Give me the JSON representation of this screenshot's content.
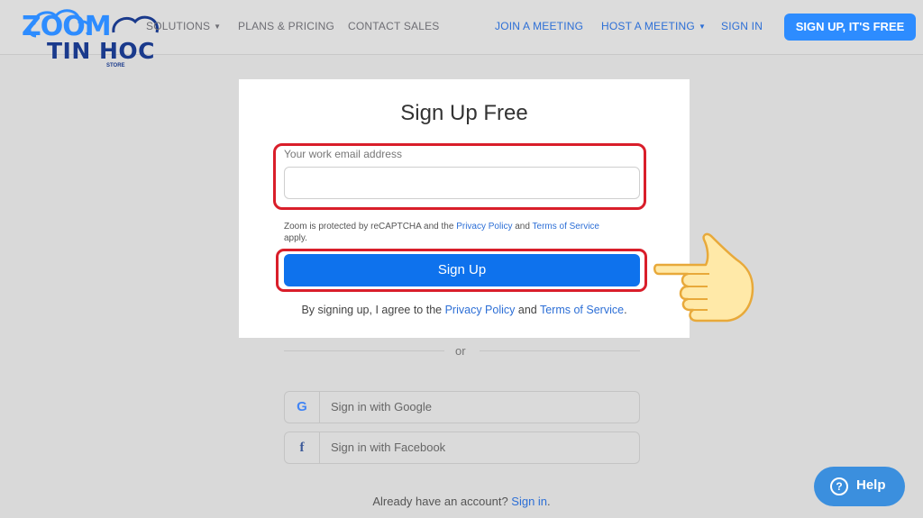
{
  "logo": {
    "brand": "ZOOM",
    "tin_hoc": "TIN HOC",
    "store": "STORE"
  },
  "nav": {
    "solutions": "SOLUTIONS",
    "plans": "PLANS & PRICING",
    "contact": "CONTACT SALES",
    "join": "JOIN A MEETING",
    "host": "HOST A MEETING",
    "signin": "SIGN IN",
    "signup": "SIGN UP, IT'S FREE"
  },
  "form": {
    "title": "Sign Up Free",
    "email_label": "Your work email address",
    "email_value": "",
    "recaptcha_text_1": "Zoom is protected by reCAPTCHA and the ",
    "recaptcha_privacy": "Privacy Policy",
    "recaptcha_and": " and ",
    "recaptcha_terms": "Terms of Service",
    "recaptcha_apply": " apply.",
    "signup_button": "Sign Up",
    "agree_prefix": "By signing up, I agree to the ",
    "agree_privacy": "Privacy Policy",
    "agree_and": " and ",
    "agree_terms": "Terms of Service",
    "agree_suffix": "."
  },
  "divider": {
    "or": "or"
  },
  "social": {
    "google_icon": "G",
    "google": "Sign in with Google",
    "facebook_icon": "f",
    "facebook": "Sign in with Facebook"
  },
  "footer": {
    "already": "Already have an account? ",
    "signin": "Sign in",
    "period": "."
  },
  "help": {
    "label": "Help",
    "icon": "?"
  },
  "colors": {
    "accent": "#2d8cff",
    "button": "#0e72ed",
    "highlight": "#d91e2a",
    "link": "#2d6fd6"
  }
}
